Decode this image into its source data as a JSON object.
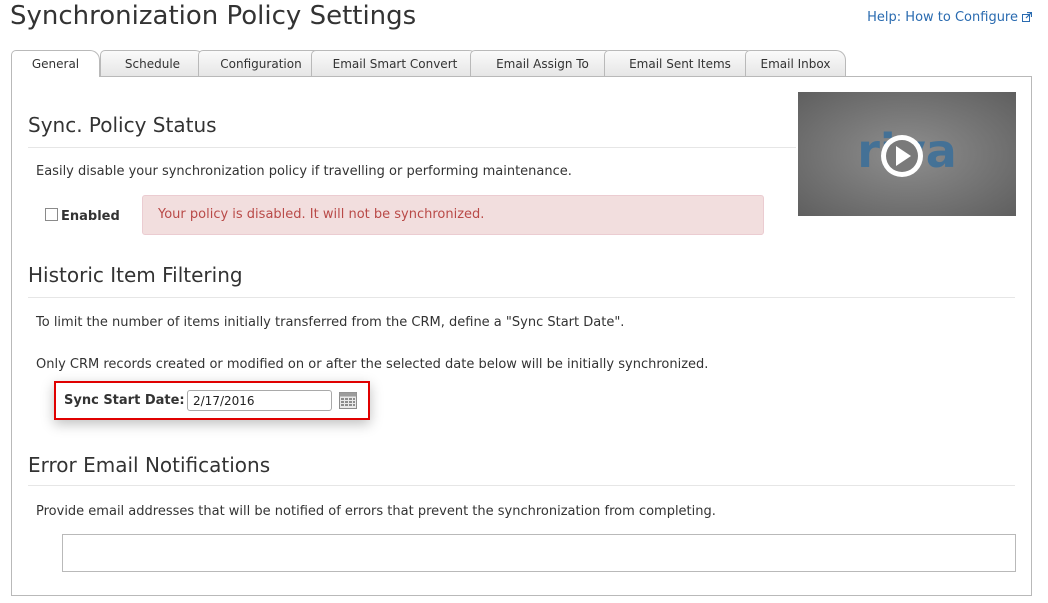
{
  "page": {
    "title": "Synchronization Policy Settings",
    "help_link": "Help: How to Configure"
  },
  "tabs": [
    {
      "label": "General",
      "active": true
    },
    {
      "label": "Schedule"
    },
    {
      "label": "Configuration"
    },
    {
      "label": "Email Smart Convert"
    },
    {
      "label": "Email Assign To"
    },
    {
      "label": "Email Sent Items"
    },
    {
      "label": "Email Inbox"
    }
  ],
  "status_section": {
    "title": "Sync. Policy Status",
    "description": "Easily disable your synchronization policy if travelling or performing maintenance.",
    "enabled_label": "Enabled",
    "enabled_checked": false,
    "alert": "Your policy is disabled. It will not be synchronized."
  },
  "video": {
    "logo_text": "riva",
    "icon": "play-icon"
  },
  "historic_section": {
    "title": "Historic Item Filtering",
    "description1": "To limit the number of items initially transferred from the CRM, define a \"Sync Start Date\".",
    "description2": "Only CRM records created or modified on or after the selected date below will be initially synchronized.",
    "date_label": "Sync Start Date:",
    "date_value": "2/17/2016",
    "calendar_icon": "calendar-icon"
  },
  "error_section": {
    "title": "Error Email Notifications",
    "description": "Provide email addresses that will be notified of errors that prevent the synchronization from completing.",
    "email_value": ""
  },
  "colors": {
    "link": "#2a6bb0",
    "alert_bg": "#f2dede",
    "alert_text": "#b94a48",
    "highlight": "#e00000"
  }
}
